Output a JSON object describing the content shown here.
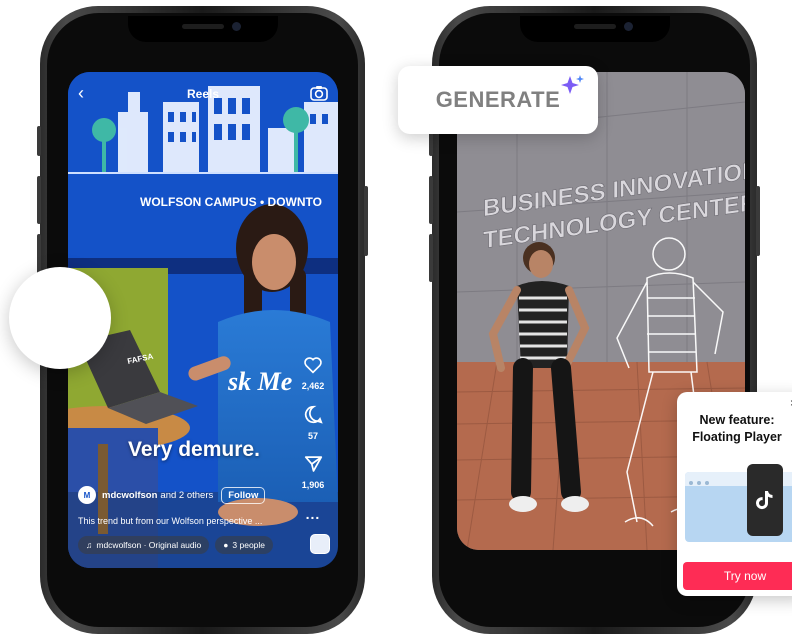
{
  "reels": {
    "title": "Reels",
    "likes": "2,462",
    "comments": "57",
    "shares": "1,906",
    "more": "...",
    "caption": "Very demure.",
    "username": "mdcwolfson",
    "coauthors": "and 2 others",
    "follow_label": "Follow",
    "description": "This trend but from our Wolfson perspective ...",
    "audio": "mdcwolfson · Original audio",
    "people": "3 people",
    "sign_text": "WOLFSON CAMPUS • DOWNTO",
    "shirt_text": "sk Me",
    "laptop_sticker": "FAFSA"
  },
  "generate": {
    "label": "GENERATE",
    "wall_line1": "BUSINESS INNOVATION",
    "wall_line2": "TECHNOLOGY CENTER"
  },
  "floating_player": {
    "title_line1": "New feature:",
    "title_line2": "Floating Player",
    "close": "×",
    "cta": "Try now"
  },
  "colors": {
    "reels_blue": "#1452c8",
    "tiktok_red": "#fe2c55",
    "waveform_gradient": [
      "#3a6df0",
      "#8a3ff0"
    ],
    "sparkle": "#7b5cf5"
  }
}
